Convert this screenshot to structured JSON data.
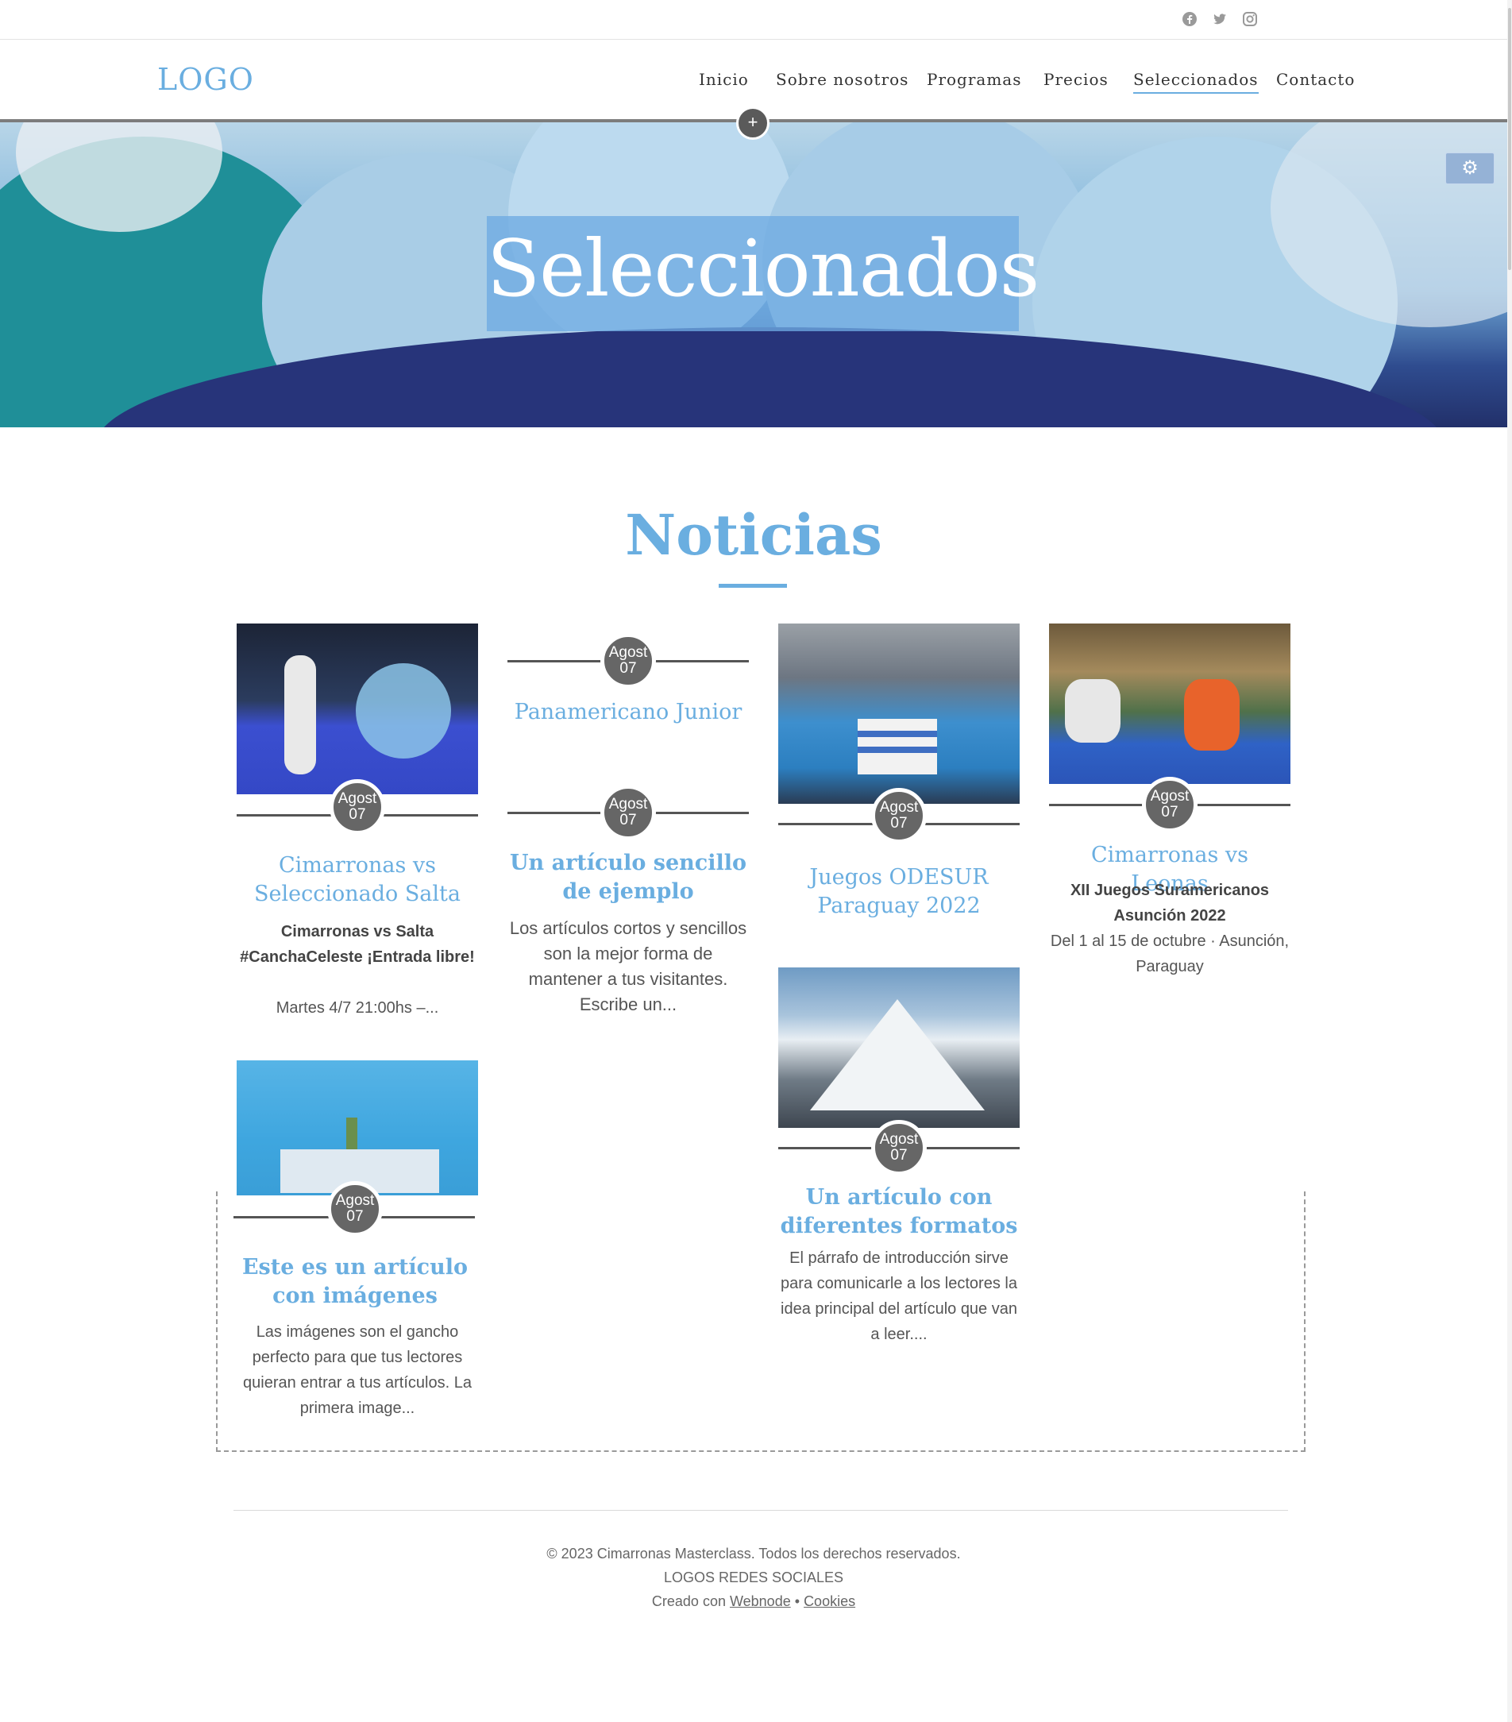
{
  "topbar": {
    "social": [
      {
        "icon": "facebook-icon"
      },
      {
        "icon": "twitter-icon"
      },
      {
        "icon": "instagram-icon"
      }
    ]
  },
  "header": {
    "logo": "LOGO",
    "nav": [
      {
        "label": "Inicio",
        "active": false
      },
      {
        "label": "Sobre nosotros",
        "active": false
      },
      {
        "label": "Programas",
        "active": false
      },
      {
        "label": "Precios",
        "active": false
      },
      {
        "label": "Seleccionados",
        "active": true
      },
      {
        "label": "Contacto",
        "active": false
      }
    ]
  },
  "hero": {
    "title": "Seleccionados",
    "add_button": "+",
    "settings_icon": "gear-icon"
  },
  "news": {
    "title": "Noticias",
    "cards": [
      {
        "date_month": "Agost",
        "date_day": "07",
        "title": "Cimarronas vs Seleccionado Salta",
        "lead": "Cimarronas vs Salta #CanchaCeleste ¡Entrada libre!",
        "text": "Martes 4/7 21:00hs –..."
      },
      {
        "date_month": "Agost",
        "date_day": "07",
        "title": "Panamericano Junior"
      },
      {
        "date_month": "Agost",
        "date_day": "07",
        "title": "Un artículo sencillo de ejemplo",
        "text": "Los artículos cortos y sencillos son la mejor forma de mantener a tus visitantes. Escribe un..."
      },
      {
        "date_month": "Agost",
        "date_day": "07",
        "title": "Juegos ODESUR Paraguay 2022"
      },
      {
        "date_month": "Agost",
        "date_day": "07",
        "title": "Cimarronas vs Leonas",
        "lead": "XII Juegos Suramericanos Asunción 2022",
        "text": "Del 1 al 15 de octubre · Asunción, Paraguay"
      },
      {
        "date_month": "Agost",
        "date_day": "07",
        "title": "Este es un artículo con imágenes",
        "text": "Las imágenes son el gancho perfecto para que tus lectores quieran entrar a tus artículos. La primera image..."
      },
      {
        "date_month": "Agost",
        "date_day": "07",
        "title": "Un artículo con diferentes formatos",
        "text": "El párrafo de introducción sirve para comunicarle a los lectores la idea principal del artículo que van a leer...."
      }
    ]
  },
  "footer": {
    "copyright": "© 2023 Cimarronas Masterclass. Todos los derechos reservados.",
    "social_logos": "LOGOS REDES SOCIALES",
    "created_with": "Creado con",
    "webnode": "Webnode",
    "separator": "•",
    "cookies": "Cookies"
  },
  "colors": {
    "accent": "#6aaee0",
    "date_badge": "#666666",
    "text": "#555555"
  }
}
